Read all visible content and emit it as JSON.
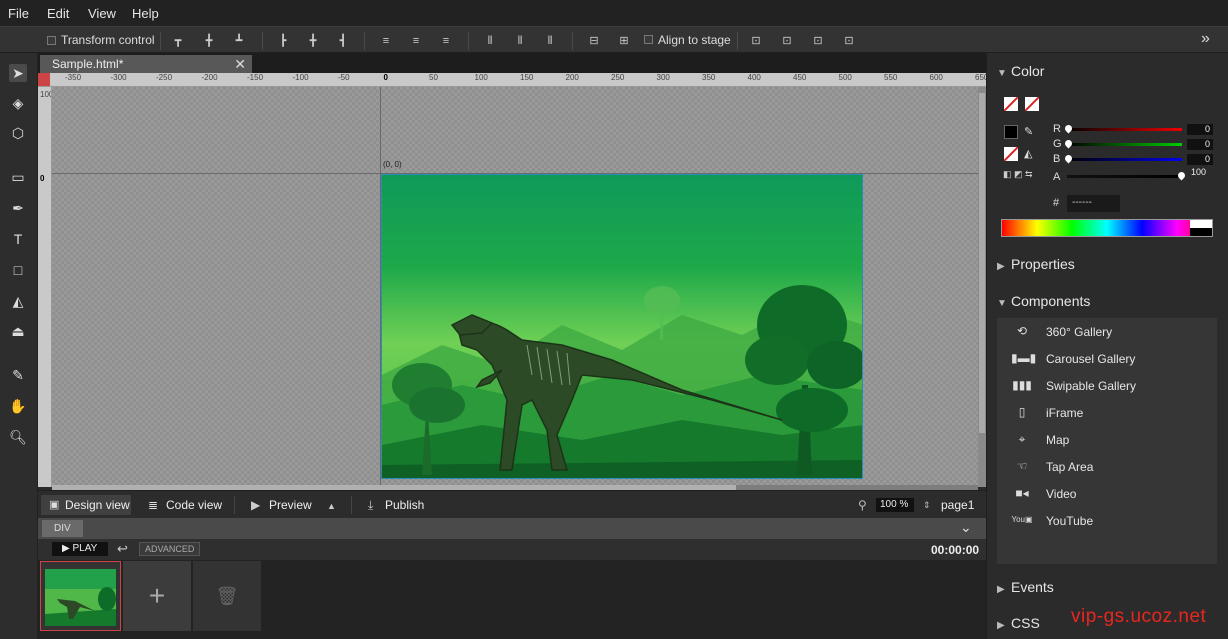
{
  "menu": {
    "file": "File",
    "edit": "Edit",
    "view": "View",
    "help": "Help"
  },
  "toolbar": {
    "transform_label": "Transform control",
    "align_stage_label": "Align to stage",
    "more": "»"
  },
  "document": {
    "tab_title": "Sample.html*",
    "close": "✕",
    "origin_label": "(0, 0)"
  },
  "ruler": {
    "h_ticks": [
      "-350",
      "-300",
      "-250",
      "-200",
      "-150",
      "-100",
      "-50",
      "0",
      "50",
      "100",
      "150",
      "200",
      "250",
      "300",
      "350",
      "400",
      "450",
      "500",
      "550",
      "600",
      "650"
    ],
    "v_ticks_top": "100",
    "v_ticks_mid": "0"
  },
  "viewbar": {
    "design": "Design view",
    "code": "Code view",
    "preview": "Preview",
    "publish": "Publish",
    "zoom": "100 %",
    "page": "page1"
  },
  "breadcrumb": {
    "item": "DIV"
  },
  "timeline": {
    "play": "PLAY",
    "advanced": "ADVANCED",
    "time": "00:00:00"
  },
  "pages": {
    "add": "+",
    "delete": "🗑"
  },
  "panel": {
    "color": {
      "title": "Color",
      "r_label": "R",
      "g_label": "G",
      "b_label": "B",
      "a_label": "A",
      "r": "0",
      "g": "0",
      "b": "0",
      "a": "100",
      "hash": "#",
      "hex": "------"
    },
    "properties": "Properties",
    "components_title": "Components",
    "components": [
      {
        "label": "360° Gallery",
        "icon": "gallery360-icon"
      },
      {
        "label": "Carousel Gallery",
        "icon": "carousel-icon"
      },
      {
        "label": "Swipable Gallery",
        "icon": "swipe-icon"
      },
      {
        "label": "iFrame",
        "icon": "iframe-icon"
      },
      {
        "label": "Map",
        "icon": "map-icon"
      },
      {
        "label": "Tap Area",
        "icon": "tap-icon"
      },
      {
        "label": "Video",
        "icon": "video-icon"
      },
      {
        "label": "YouTube",
        "icon": "youtube-icon"
      }
    ],
    "events": "Events",
    "css": "CSS"
  },
  "watermark": "vip-gs.ucoz.net"
}
